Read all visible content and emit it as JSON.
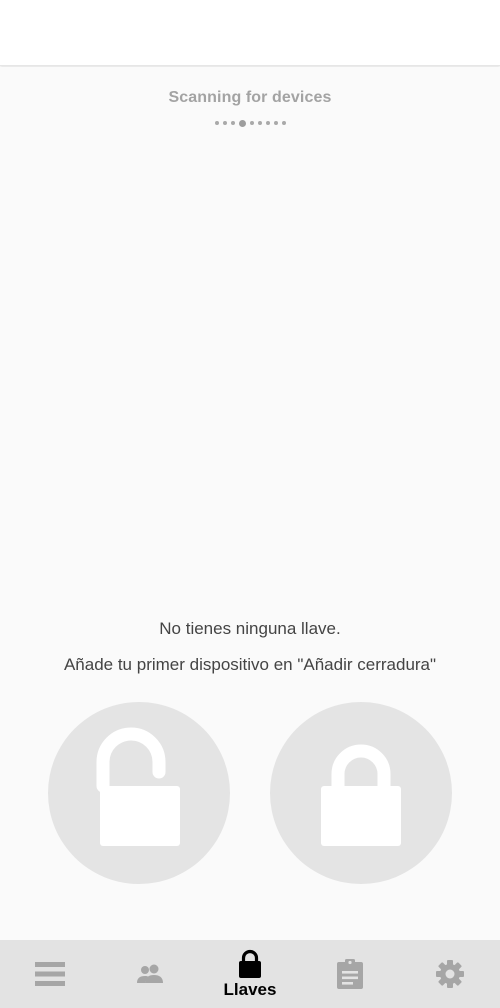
{
  "scanner": {
    "status_text": "Scanning for devices",
    "dots": 9,
    "active_dot": 3
  },
  "empty_state": {
    "title": "No tienes ninguna llave.",
    "subtitle": "Añade tu primer dispositivo en \"Añadir cerradura\""
  },
  "actions": {
    "unlock_icon": "unlock-icon",
    "lock_icon": "lock-icon"
  },
  "bottom_nav": {
    "items": [
      {
        "icon": "menu-icon",
        "label": ""
      },
      {
        "icon": "people-icon",
        "label": ""
      },
      {
        "icon": "lock-icon",
        "label": "Llaves",
        "active": true
      },
      {
        "icon": "clipboard-icon",
        "label": ""
      },
      {
        "icon": "gear-icon",
        "label": ""
      }
    ]
  },
  "colors": {
    "nav_background": "#e3e3e3",
    "icon_inactive": "#a6a6a6",
    "icon_active": "#000000",
    "button_circle": "#e4e4e4",
    "text_muted": "#a3a3a3"
  }
}
